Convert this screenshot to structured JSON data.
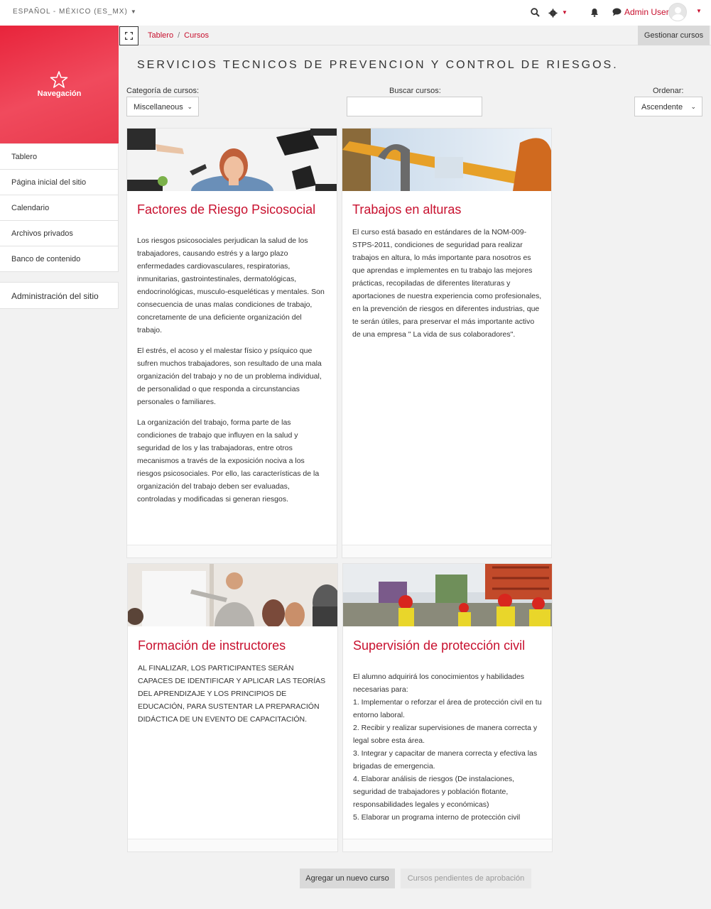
{
  "topbar": {
    "language": "ESPAÑOL - MÉXICO (ES_MX)",
    "user_name": "Admin User",
    "icons": [
      "search-icon",
      "gear-icon",
      "bell-icon",
      "chat-icon",
      "avatar-icon"
    ]
  },
  "drawer": {
    "title": "Navegación",
    "items": [
      {
        "label": "Tablero"
      },
      {
        "label": "Página inicial del sitio"
      },
      {
        "label": "Calendario"
      },
      {
        "label": "Archivos privados"
      },
      {
        "label": "Banco de contenido"
      }
    ],
    "admin_label": "Administración del sitio"
  },
  "breadcrumb": [
    "Tablero",
    "Cursos"
  ],
  "manage_button": "Gestionar cursos",
  "page_title": "SERVICIOS TECNICOS DE PREVENCION Y CONTROL DE RIESGOS.",
  "filters": {
    "category_label": "Categoría de cursos:",
    "category_value": "Miscellaneous",
    "search_label": "Buscar cursos:",
    "search_value": "",
    "order_label": "Ordenar:",
    "order_value": "Ascendente"
  },
  "courses": [
    {
      "title": "Factores de Riesgo Psicosocial",
      "paragraphs": [
        "Los riesgos psicosociales perjudican la salud de los trabajadores, causando estrés y a largo plazo enfermedades cardiovasculares, respiratorias, inmunitarias, gastrointestinales, dermatológicas, endocrinológicas, musculo-esqueléticas y mentales. Son consecuencia de unas malas condiciones de trabajo, concretamente de una deficiente organización del trabajo.",
        " El estrés, el acoso y el malestar físico y psíquico que sufren muchos trabajadores, son resultado de una mala organización del trabajo y no de un problema individual, de personalidad o que responda a circunstancias personales o familiares.",
        "La organización del trabajo, forma parte de las condiciones de trabajo que influyen en la salud y seguridad de los y las trabajadoras, entre otros mecanismos a través de la exposición nociva a los riesgos psicosociales. Por ello, las características de la organización del trabajo deben ser evaluadas, controladas y modificadas si generan riesgos."
      ]
    },
    {
      "title": "Trabajos en alturas",
      "paragraphs": [
        "El curso está basado en estándares de la NOM-009-STPS-2011, condiciones de seguridad para realizar trabajos en altura, lo más importante para nosotros es que aprendas e implementes en tu trabajo las mejores prácticas, recopiladas de diferentes literaturas y aportaciones de nuestra experiencia como profesionales, en la prevención de riesgos en diferentes industrias, que te serán útiles, para preservar el más importante activo de una empresa \" La vida de sus colaboradores\"."
      ]
    },
    {
      "title": "Formación de instructores",
      "paragraphs": [
        "AL FINALIZAR, LOS PARTICIPANTES SERÁN CAPACES DE IDENTIFICAR Y APLICAR LAS TEORÍAS DEL APRENDIZAJE Y LOS PRINCIPIOS DE EDUCACIÓN, PARA SUSTENTAR LA PREPARACIÓN DIDÁCTICA DE UN EVENTO DE CAPACITACIÓN."
      ]
    },
    {
      "title": "Supervisión de protección civil",
      "paragraphs": [
        "El alumno adquirirá los conocimientos y habilidades necesarias para:",
        "1. Implementar o reforzar el área de protección civil en tu entorno laboral.",
        "2. Recibir y realizar supervisiones de manera correcta y legal sobre esta área.",
        "3. Integrar y capacitar de manera correcta y efectiva las brigadas de emergencia.",
        "4. Elaborar análisis de riesgos (De instalaciones, seguridad de trabajadores y población flotante, responsabilidades legales y económicas)",
        "5. Elaborar un programa interno de protección civil"
      ]
    }
  ],
  "actions": {
    "add_course": "Agregar un nuevo curso",
    "pending_courses": "Cursos pendientes de aprobación"
  },
  "colors": {
    "accent": "#c8102e",
    "drawer_gradient_start": "#e8243b",
    "drawer_gradient_end": "#f04a5d"
  }
}
